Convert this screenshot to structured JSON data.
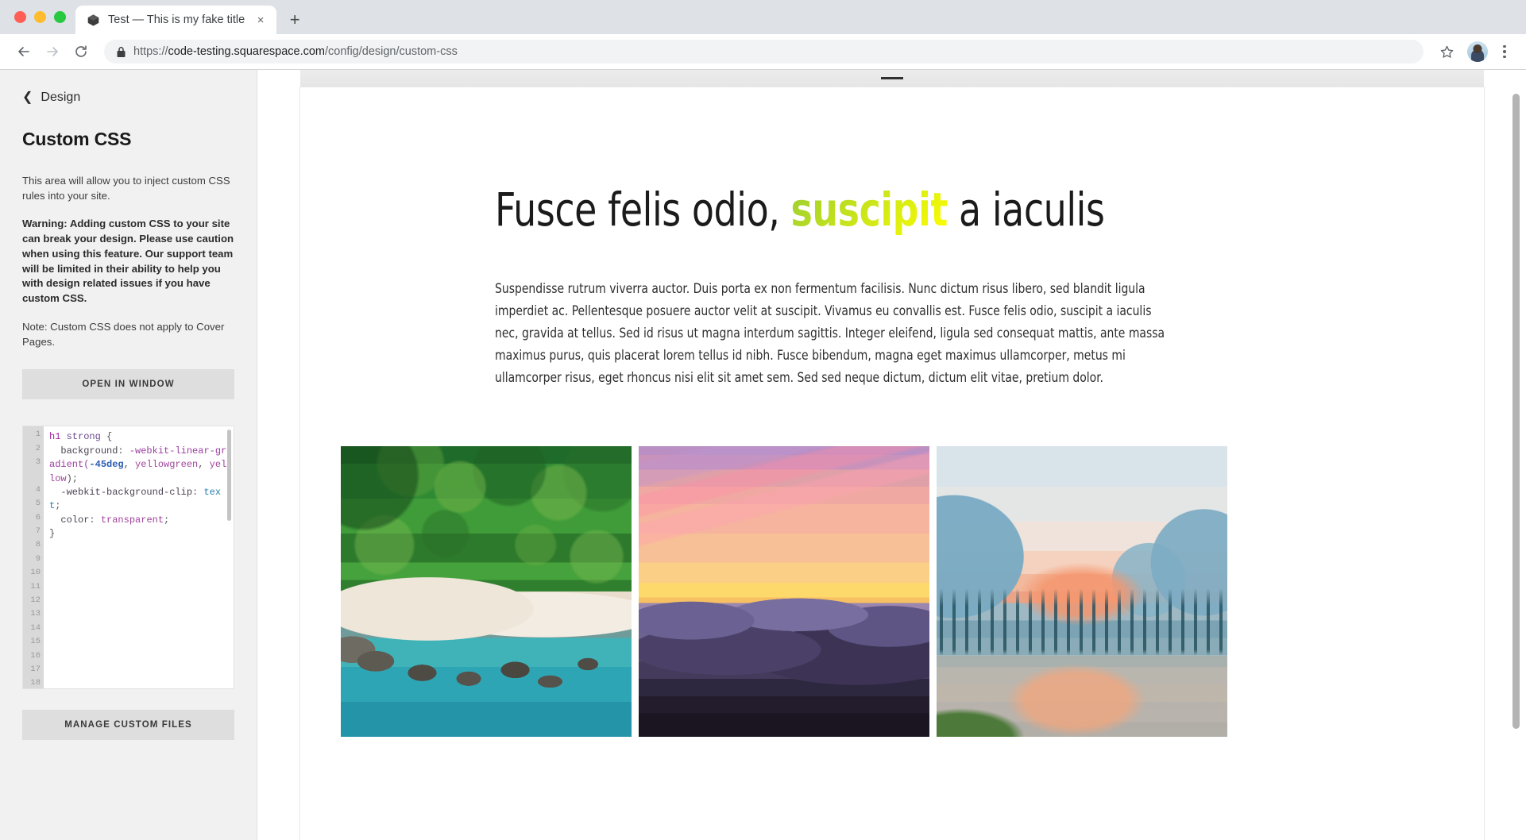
{
  "browser": {
    "tab": {
      "title": "Test — This is my fake title",
      "favicon_icon": "cube-icon",
      "close_icon": "×"
    },
    "newtab_icon": "+",
    "back_icon": "←",
    "forward_icon": "→",
    "reload_icon": "⟳",
    "lock_icon": "lock-icon",
    "url_scheme": "https://",
    "url_host": "code-testing.squarespace.com",
    "url_path": "/config/design/custom-css",
    "star_icon": "☆",
    "avatar_icon": "profile-avatar",
    "menu_icon": "kebab-menu-icon"
  },
  "sidebar": {
    "back_label": "Design",
    "back_chevron": "❮",
    "title": "Custom CSS",
    "intro": "This area will allow you to inject custom CSS rules into your site.",
    "warning": "Warning: Adding custom CSS to your site can break your design. Please use caution when using this feature. Our support team will be limited in their ability to help you with design related issues if you have custom CSS.",
    "note": "Note: Custom CSS does not apply to Cover Pages.",
    "open_button": "OPEN IN WINDOW",
    "manage_button": "MANAGE CUSTOM FILES",
    "editor": {
      "line_numbers": [
        1,
        2,
        3,
        4,
        5,
        6,
        7,
        8,
        9,
        10,
        11,
        12,
        13,
        14,
        15,
        16,
        17,
        18
      ],
      "code_lines": [
        "h1 strong {",
        "  background: -webkit-linear-gradient(-45deg, yellowgreen, yellow);",
        "  -webkit-background-clip: text;",
        "  color: transparent;",
        "}"
      ],
      "tokens": {
        "selector": "h1",
        "element": "strong",
        "prop_background": "background",
        "fn": "-webkit-linear-gradient",
        "angle": "-45deg",
        "color_1": "yellowgreen",
        "color_2": "yellow",
        "prop_clip": "-webkit-background-clip",
        "value_text": "text",
        "prop_color": "color",
        "value_transparent": "transparent"
      }
    }
  },
  "preview": {
    "drag_handle_icon": "drag-handle",
    "heading_before": "Fusce felis odio, ",
    "heading_highlight": "suscipit",
    "heading_after": " a iaculis",
    "paragraph": "Suspendisse rutrum viverra auctor. Duis porta ex non fermentum facilisis. Nunc dictum risus libero, sed blandit ligula imperdiet ac. Pellentesque posuere auctor velit at suscipit. Vivamus eu convallis est. Fusce felis odio, suscipit a iaculis nec, gravida at tellus. Sed id risus ut magna interdum sagittis. Integer eleifend, ligula sed consequat mattis, ante massa maximus purus, quis placerat lorem tellus id nibh. Fusce bibendum, magna eget maximus ullamcorper, metus mi ullamcorper risus, eget rhoncus nisi elit sit amet sem. Sed sed neque dictum, dictum elit vitae, pretium dolor.",
    "gallery": [
      {
        "name": "aerial-beach-photo"
      },
      {
        "name": "sunset-mountains-photo"
      },
      {
        "name": "valley-river-photo"
      }
    ]
  },
  "colors": {
    "gradient_start": "#9acd32",
    "gradient_end": "#ffff00",
    "sidebar_bg": "#f1f1f1",
    "button_bg": "#dedede",
    "tabstrip_bg": "#dee1e6"
  }
}
